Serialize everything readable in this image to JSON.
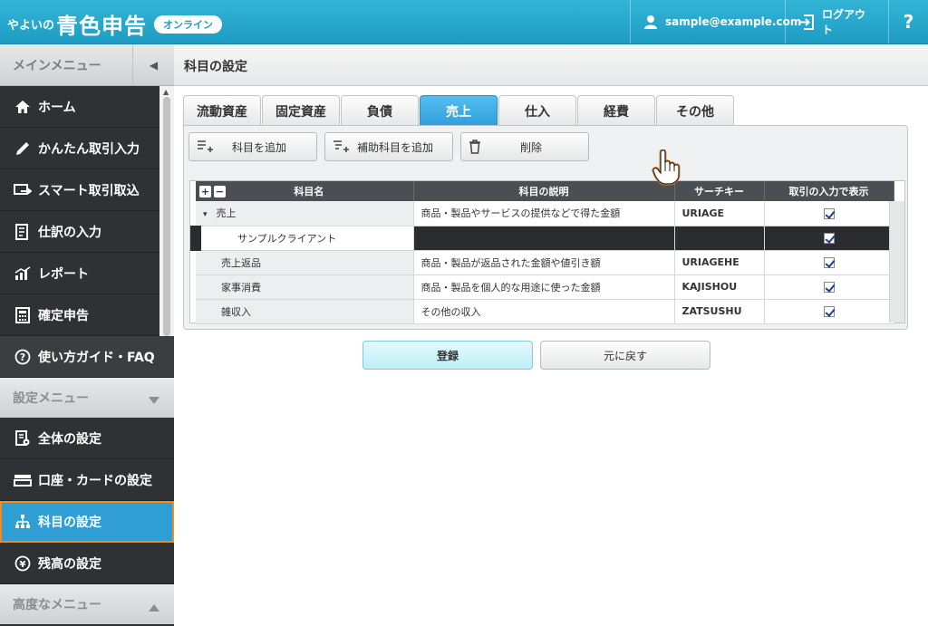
{
  "header": {
    "logo_small": "やよいの",
    "logo_big": "青色申告",
    "logo_badge": "オンライン",
    "user_email": "sample@example.com",
    "logout_label": "ログアウト",
    "help_label": "?"
  },
  "sidebar": {
    "main_menu_label": "メインメニュー",
    "items": [
      {
        "label": "ホーム",
        "icon": "home-icon"
      },
      {
        "label": "かんたん取引入力",
        "icon": "pencil-icon"
      },
      {
        "label": "スマート取引取込",
        "icon": "import-icon"
      },
      {
        "label": "仕訳の入力",
        "icon": "journal-icon"
      },
      {
        "label": "レポート",
        "icon": "chart-icon"
      },
      {
        "label": "確定申告",
        "icon": "calculator-icon"
      }
    ],
    "faq_label": "使い方ガイド・FAQ",
    "settings_menu_label": "設定メニュー",
    "settings_items": [
      {
        "label": "全体の設定",
        "icon": "settings-doc-icon"
      },
      {
        "label": "口座・カードの設定",
        "icon": "card-icon"
      },
      {
        "label": "科目の設定",
        "icon": "tree-icon",
        "active": true
      },
      {
        "label": "残高の設定",
        "icon": "yen-icon"
      }
    ],
    "advanced_menu_label": "高度なメニュー"
  },
  "page": {
    "title": "科目の設定"
  },
  "tabs": [
    "流動資産",
    "固定資産",
    "負債",
    "売上",
    "仕入",
    "経費",
    "その他"
  ],
  "active_tab": "売上",
  "toolbar": {
    "add_account": "科目を追加",
    "add_sub_account": "補助科目を追加",
    "delete": "削除"
  },
  "table": {
    "headers": [
      "科目名",
      "科目の説明",
      "サーチキー",
      "取引の入力で表示"
    ],
    "rows": [
      {
        "name": "売上",
        "desc": "商品・製品やサービスの提供などで得た金額",
        "key": "URIAGE",
        "show": true,
        "expand": "▾"
      },
      {
        "name": "サンプルクライアント",
        "desc": "",
        "key": "",
        "show": true,
        "selected": true
      },
      {
        "name": "売上返品",
        "desc": "商品・製品が返品された金額や値引き額",
        "key": "URIAGEHE",
        "show": true
      },
      {
        "name": "家事消費",
        "desc": "商品・製品を個人的な用途に使った金額",
        "key": "KAJISHOU",
        "show": true
      },
      {
        "name": "雑収入",
        "desc": "その他の収入",
        "key": "ZATSUSHU",
        "show": true
      }
    ]
  },
  "actions": {
    "register": "登録",
    "undo": "元に戻す"
  },
  "colors": {
    "header": "#1e9cc3",
    "active_tab": "#2d9fdb",
    "active_sidebar": "#2f9ed4",
    "highlight_outline": "#f08a24"
  }
}
